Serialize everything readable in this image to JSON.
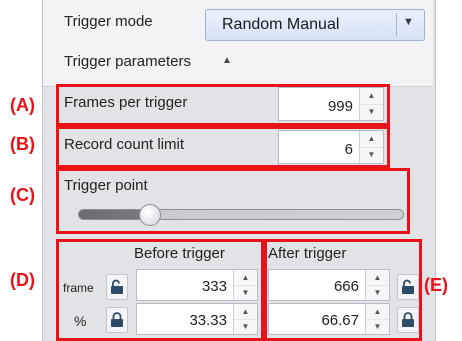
{
  "trigger_mode": {
    "label": "Trigger mode",
    "value": "Random Manual"
  },
  "trigger_parameters": {
    "label": "Trigger parameters",
    "chevron": "▲"
  },
  "frames_per_trigger": {
    "label": "Frames per trigger",
    "value": "999"
  },
  "record_count_limit": {
    "label": "Record count limit",
    "value": "6"
  },
  "trigger_point": {
    "label": "Trigger point",
    "slider_fraction": 0.22
  },
  "before_trigger": {
    "header": "Before trigger",
    "frame_value": "333",
    "percent_value": "33.33"
  },
  "after_trigger": {
    "header": "After trigger",
    "frame_value": "666",
    "percent_value": "66.67"
  },
  "row_labels": {
    "frame": "frame",
    "percent": "%"
  },
  "annotations": {
    "a": "(A)",
    "b": "(B)",
    "c": "(C)",
    "d": "(D)",
    "e": "(E)"
  },
  "icons": {
    "spin_up": "▲",
    "spin_down": "▼",
    "combo_arrow": "▼"
  },
  "colors": {
    "annotation_red": "#e8121a",
    "panel_bg": "#e2e3e6",
    "combo_bg": "#dde8f7"
  }
}
